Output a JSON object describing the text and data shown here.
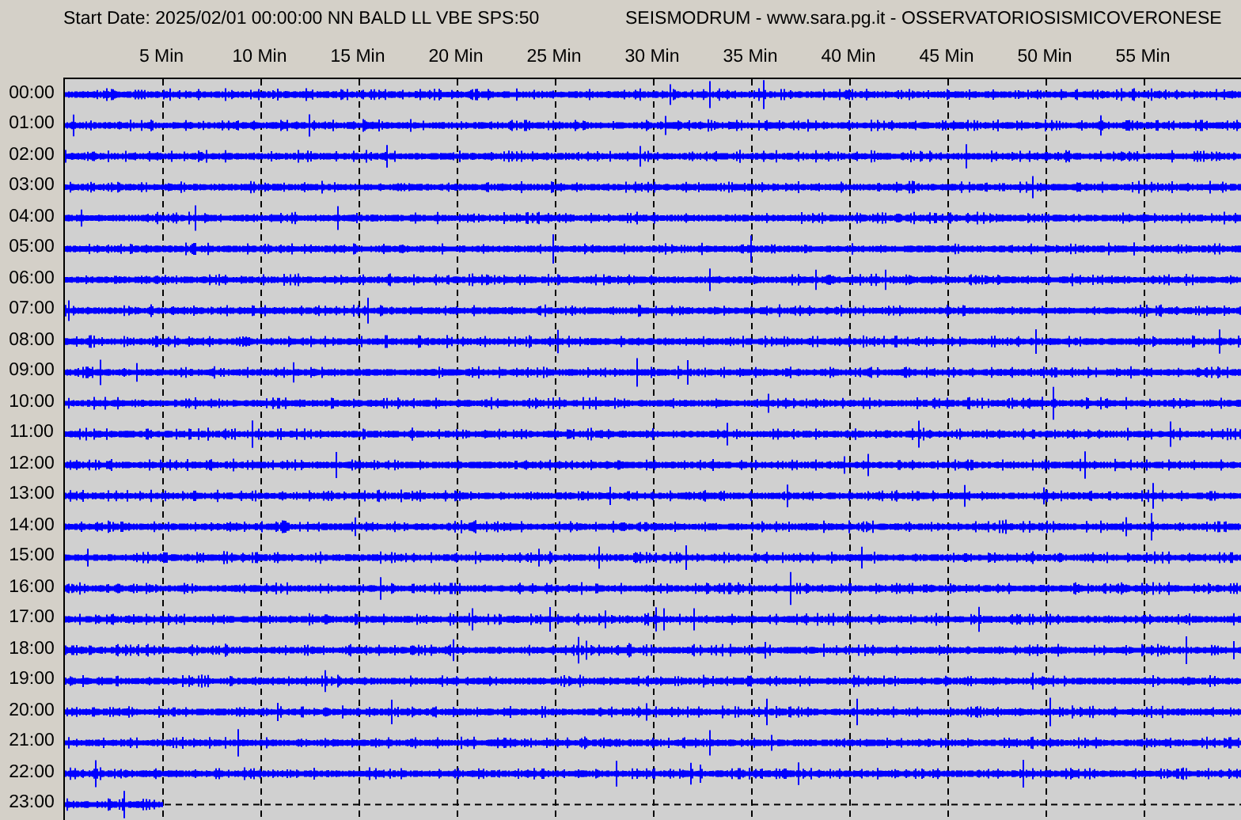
{
  "header": {
    "start_info": "Start Date: 2025/02/01 00:00:00 NN BALD LL VBE SPS:50",
    "title": "SEISMODRUM - www.sara.pg.it - OSSERVATORIOSISMICOVERONESE"
  },
  "minute_labels": [
    "5 Min",
    "10 Min",
    "15 Min",
    "20 Min",
    "25 Min",
    "30 Min",
    "35 Min",
    "40 Min",
    "45 Min",
    "50 Min",
    "55 Min"
  ],
  "traces": [
    {
      "label": "00:00",
      "kind": "full"
    },
    {
      "label": "01:00",
      "kind": "full"
    },
    {
      "label": "02:00",
      "kind": "full"
    },
    {
      "label": "03:00",
      "kind": "full"
    },
    {
      "label": "04:00",
      "kind": "full"
    },
    {
      "label": "05:00",
      "kind": "full"
    },
    {
      "label": "06:00",
      "kind": "full"
    },
    {
      "label": "07:00",
      "kind": "full"
    },
    {
      "label": "08:00",
      "kind": "full"
    },
    {
      "label": "09:00",
      "kind": "full"
    },
    {
      "label": "10:00",
      "kind": "full"
    },
    {
      "label": "11:00",
      "kind": "full"
    },
    {
      "label": "12:00",
      "kind": "full"
    },
    {
      "label": "13:00",
      "kind": "full"
    },
    {
      "label": "14:00",
      "kind": "full"
    },
    {
      "label": "15:00",
      "kind": "full"
    },
    {
      "label": "16:00",
      "kind": "full"
    },
    {
      "label": "17:00",
      "kind": "full"
    },
    {
      "label": "18:00",
      "kind": "full"
    },
    {
      "label": "19:00",
      "kind": "full"
    },
    {
      "label": "20:00",
      "kind": "full"
    },
    {
      "label": "21:00",
      "kind": "full"
    },
    {
      "label": "22:00",
      "kind": "full"
    },
    {
      "label": "23:00",
      "kind": "partial"
    }
  ]
}
